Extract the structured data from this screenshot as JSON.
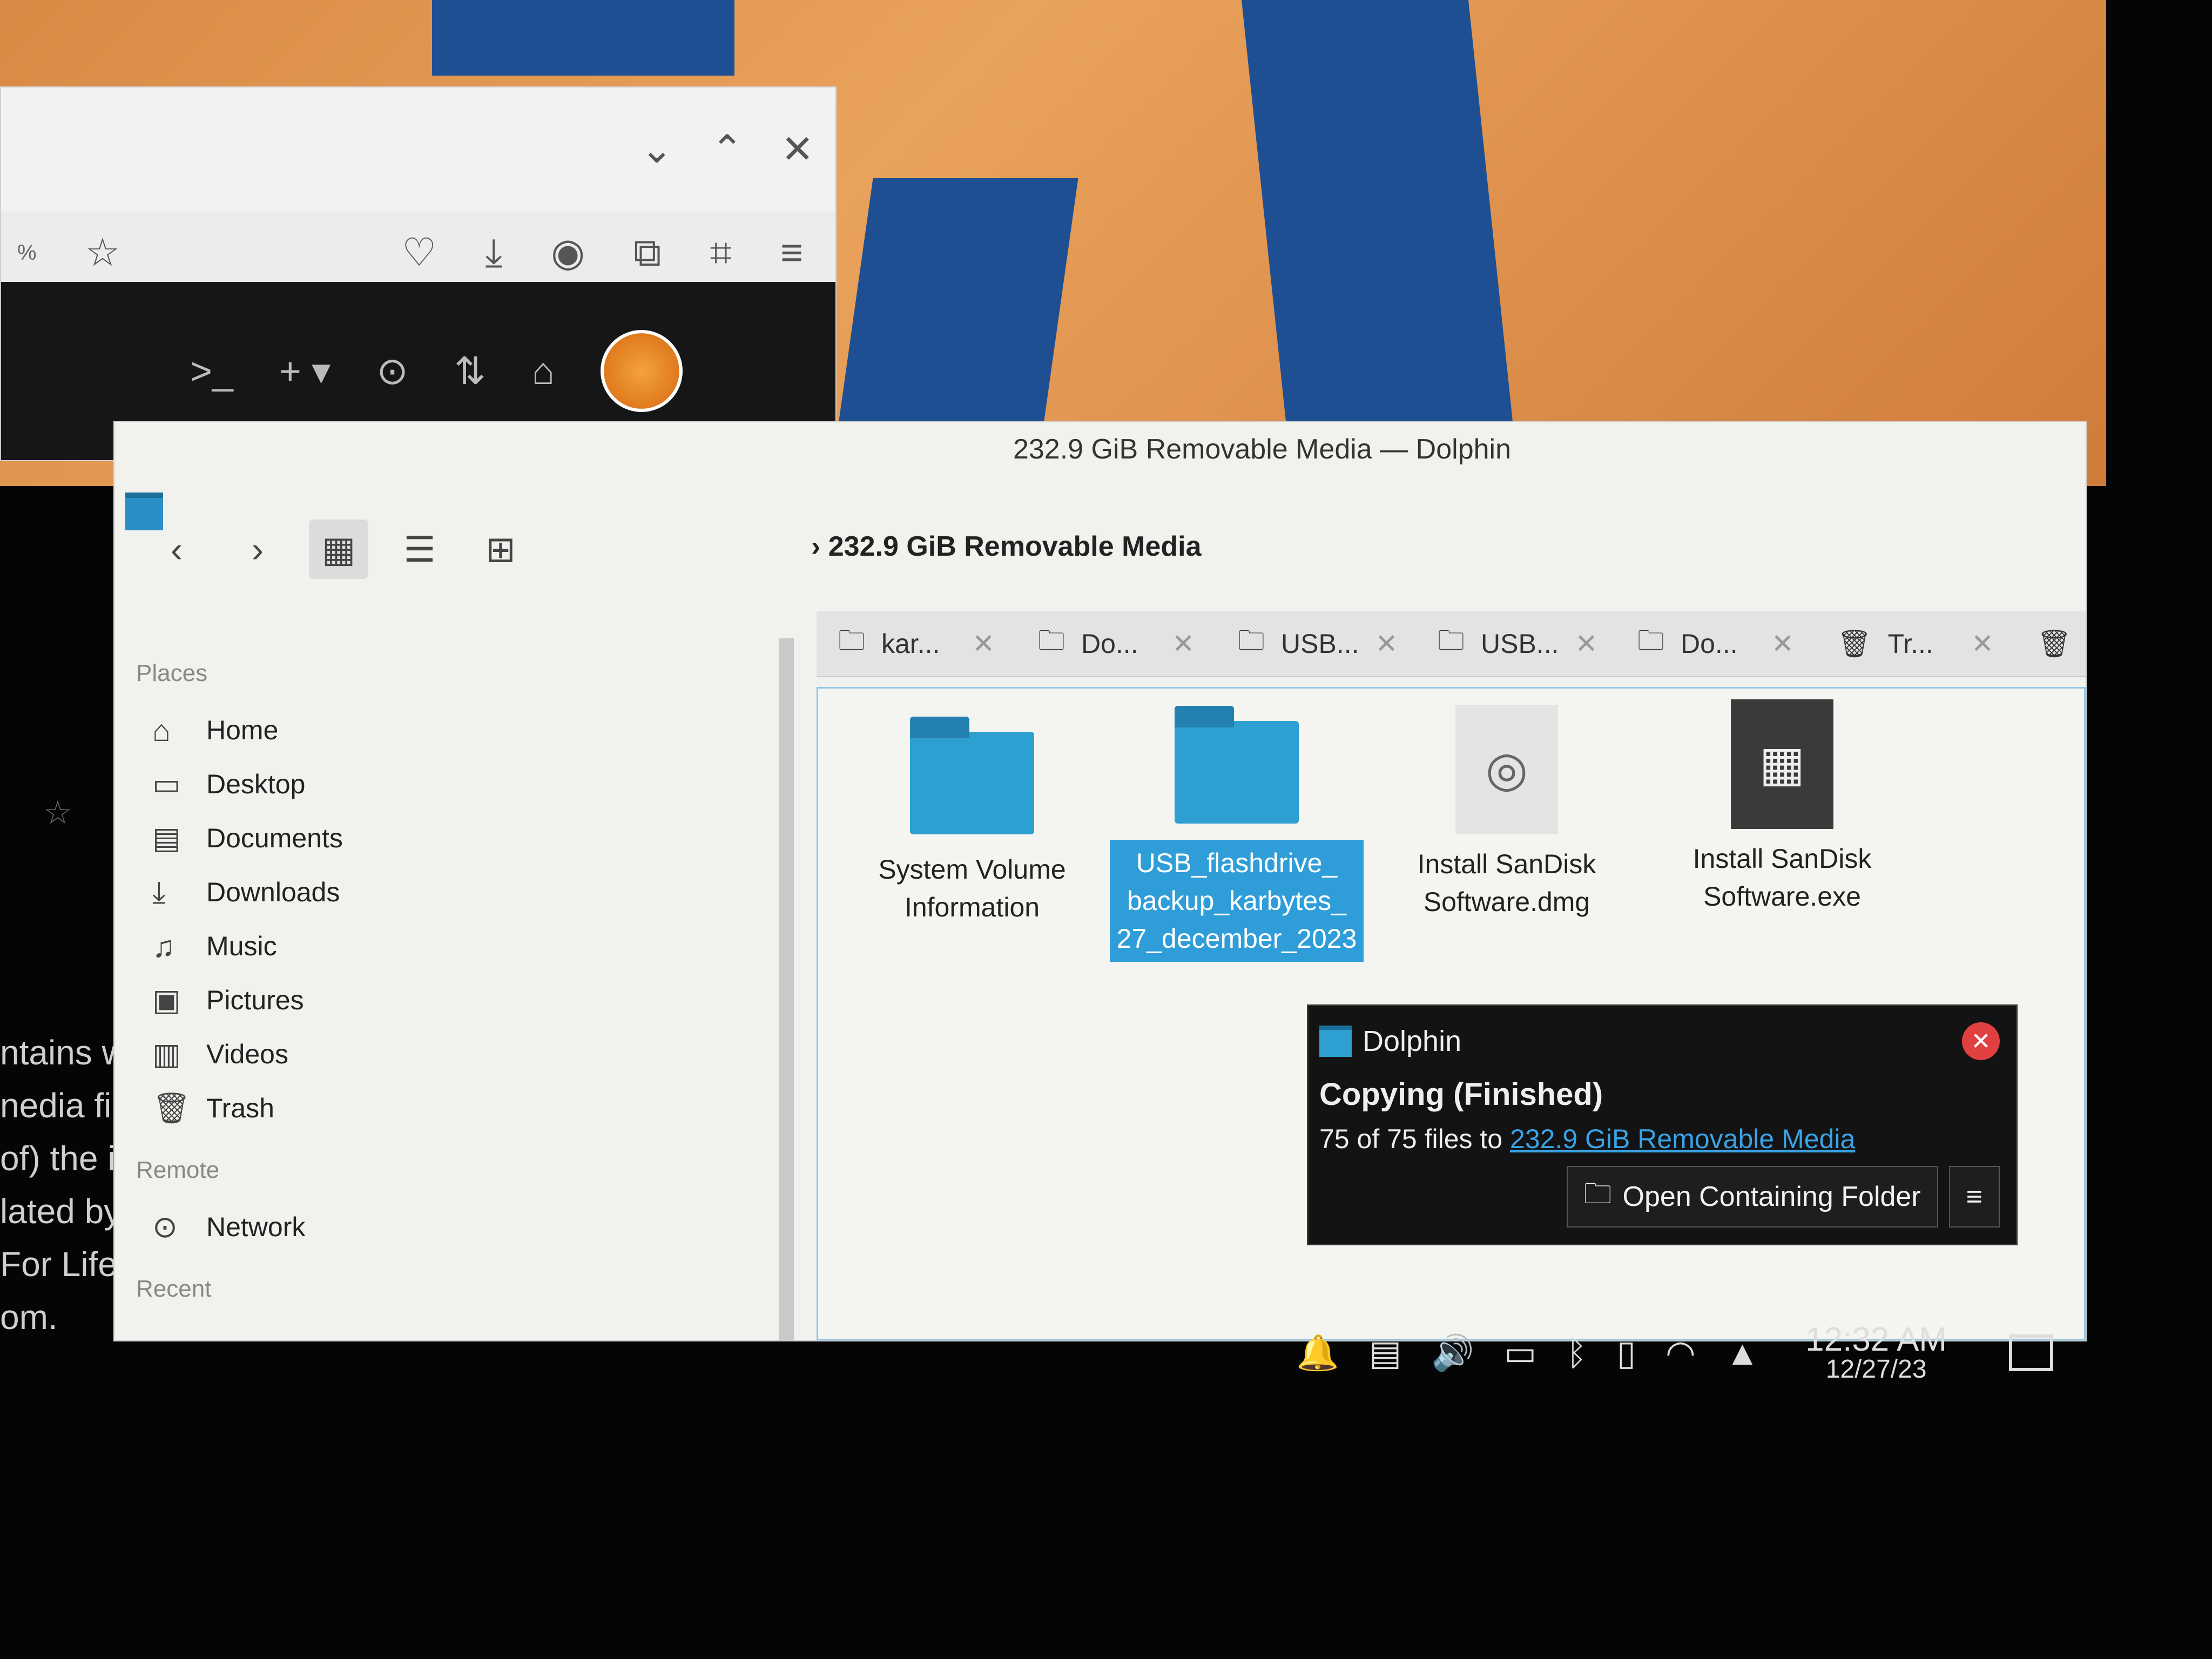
{
  "browser": {
    "zoom_text": "%",
    "toolbar_icons": [
      "star-icon",
      "pocket-icon",
      "download-icon",
      "account-icon",
      "extensions-icon",
      "screenshot-icon",
      "menu-icon"
    ],
    "dark_toolbar_icons": [
      "terminal-icon",
      "new-tab-icon",
      "target-icon",
      "merge-icon",
      "inbox-icon",
      "avatar"
    ]
  },
  "background_text": {
    "lines": [
      "ntains we",
      "nedia files",
      "of) the int",
      "lated by th",
      "For Life Blo",
      "om."
    ]
  },
  "dolphin": {
    "window_title": "232.9 GiB Removable Media — Dolphin",
    "breadcrumb": "232.9 GiB Removable Media",
    "places_header": "Places",
    "remote_header": "Remote",
    "recent_header": "Recent",
    "places": [
      {
        "label": "Home",
        "icon": "home-icon"
      },
      {
        "label": "Desktop",
        "icon": "desktop-icon"
      },
      {
        "label": "Documents",
        "icon": "documents-icon"
      },
      {
        "label": "Downloads",
        "icon": "downloads-icon"
      },
      {
        "label": "Music",
        "icon": "music-icon"
      },
      {
        "label": "Pictures",
        "icon": "pictures-icon"
      },
      {
        "label": "Videos",
        "icon": "videos-icon"
      },
      {
        "label": "Trash",
        "icon": "trash-icon"
      }
    ],
    "remote": [
      {
        "label": "Network",
        "icon": "network-icon"
      }
    ],
    "tabs": [
      "kar...",
      "Do...",
      "USB...",
      "USB...",
      "Do...",
      "Tr..."
    ],
    "files": [
      {
        "name": "System Volume Information",
        "type": "folder"
      },
      {
        "name": "USB_flashdrive_ backup_karbytes_ 27_december_2023",
        "type": "folder",
        "selected": true
      },
      {
        "name": "Install SanDisk Software.dmg",
        "type": "disk-image"
      },
      {
        "name": "Install SanDisk Software.exe",
        "type": "executable"
      }
    ]
  },
  "notification": {
    "app_name": "Dolphin",
    "summary": "Copying (Finished)",
    "body_prefix": "75 of 75 files to",
    "body_link": "232.9 GiB Removable Media",
    "action_label": "Open Containing Folder"
  },
  "tray": {
    "icons": [
      "notifications-icon",
      "clipboard-icon",
      "volume-icon",
      "battery-icon",
      "bluetooth-icon",
      "usb-drive-icon",
      "wifi-icon",
      "tray-expand-icon"
    ],
    "time": "12:32 AM",
    "date": "12/27/23"
  },
  "colors": {
    "selection": "#2f9ed8",
    "folder": "#2d9fd0",
    "wallpaper_orange": "#e09a55",
    "wallpaper_blue": "#1f4f93",
    "notification_bg": "#131313",
    "link": "#3aa3e6"
  }
}
